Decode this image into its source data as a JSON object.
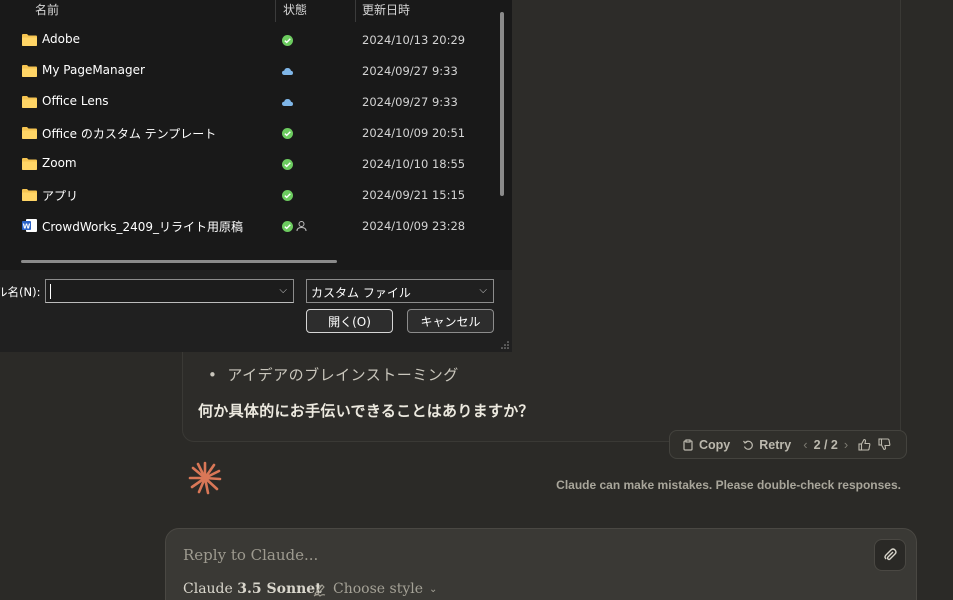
{
  "chat": {
    "bullet": "アイデアのブレインストーミング",
    "closing": "何か具体的にお手伝いできることはありますか？",
    "actions": {
      "copy": "Copy",
      "retry": "Retry",
      "pager": "2 / 2"
    },
    "disclaimer": "Claude can make mistakes. Please double-check responses."
  },
  "composer": {
    "placeholder": "Reply to Claude...",
    "model_prefix": "Claude",
    "model_version": "3.5 Sonnet",
    "style_label": "Choose style"
  },
  "dialog": {
    "columns": {
      "name": "名前",
      "status": "状態",
      "modified": "更新日時"
    },
    "files": [
      {
        "name": "Adobe",
        "type": "folder",
        "status": "synced",
        "date": "2024/10/13 20:29"
      },
      {
        "name": "My PageManager",
        "type": "folder",
        "status": "cloud",
        "date": "2024/09/27 9:33"
      },
      {
        "name": "Office Lens",
        "type": "folder",
        "status": "cloud",
        "date": "2024/09/27 9:33"
      },
      {
        "name": "Office のカスタム テンプレート",
        "type": "folder",
        "status": "synced",
        "date": "2024/10/09 20:51"
      },
      {
        "name": "Zoom",
        "type": "folder",
        "status": "synced",
        "date": "2024/10/10 18:55"
      },
      {
        "name": "アプリ",
        "type": "folder",
        "status": "synced",
        "date": "2024/09/21 15:15"
      },
      {
        "name": "CrowdWorks_2409_リライト用原稿",
        "type": "word",
        "status": "synced-shared",
        "date": "2024/10/09 23:28"
      }
    ],
    "filename_label": "ル名(N):",
    "filename_value": "",
    "filter": "カスタム ファイル",
    "open_button": "開く(O)",
    "cancel_button": "キャンセル"
  },
  "colors": {
    "folder": "#f5c451",
    "synced": "#6ccb5f",
    "cloud": "#7fb6e8",
    "claude_logo": "#d97757",
    "word": "#2b63c6"
  }
}
